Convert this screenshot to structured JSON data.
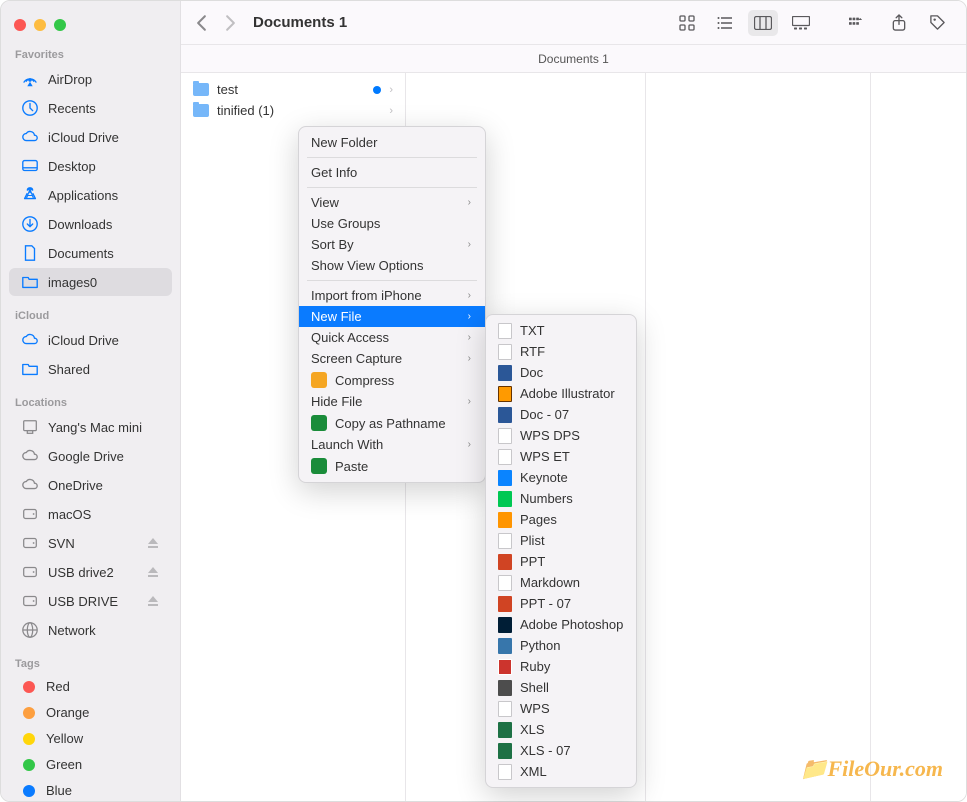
{
  "window": {
    "title": "Documents 1"
  },
  "sidebar": {
    "sections": {
      "favorites": {
        "header": "Favorites",
        "items": [
          {
            "icon": "airdrop",
            "label": "AirDrop"
          },
          {
            "icon": "clock",
            "label": "Recents"
          },
          {
            "icon": "cloud",
            "label": "iCloud Drive"
          },
          {
            "icon": "desktop",
            "label": "Desktop"
          },
          {
            "icon": "apps",
            "label": "Applications"
          },
          {
            "icon": "download",
            "label": "Downloads"
          },
          {
            "icon": "document",
            "label": "Documents"
          },
          {
            "icon": "folder",
            "label": "images0",
            "selected": true
          }
        ]
      },
      "icloud": {
        "header": "iCloud",
        "items": [
          {
            "icon": "cloud",
            "label": "iCloud Drive"
          },
          {
            "icon": "folder",
            "label": "Shared"
          }
        ]
      },
      "locations": {
        "header": "Locations",
        "items": [
          {
            "icon": "computer",
            "label": "Yang's Mac mini"
          },
          {
            "icon": "cloud",
            "label": "Google Drive"
          },
          {
            "icon": "cloud",
            "label": "OneDrive"
          },
          {
            "icon": "disk",
            "label": "macOS"
          },
          {
            "icon": "disk",
            "label": "SVN",
            "eject": true
          },
          {
            "icon": "disk",
            "label": "USB drive2",
            "eject": true
          },
          {
            "icon": "disk",
            "label": "USB DRIVE",
            "eject": true
          },
          {
            "icon": "network",
            "label": "Network"
          }
        ]
      },
      "tags": {
        "header": "Tags",
        "items": [
          {
            "color": "#fc5753",
            "label": "Red"
          },
          {
            "color": "#fd9f40",
            "label": "Orange"
          },
          {
            "color": "#ffd60a",
            "label": "Yellow"
          },
          {
            "color": "#33c748",
            "label": "Green"
          },
          {
            "color": "#0a7bff",
            "label": "Blue"
          }
        ]
      }
    }
  },
  "pathbar": {
    "label": "Documents 1"
  },
  "columns": {
    "col1": {
      "items": [
        {
          "name": "test",
          "hasTag": true
        },
        {
          "name": "tinified (1)",
          "hasTag": false
        }
      ]
    }
  },
  "context_menu": {
    "items": [
      {
        "label": "New Folder"
      },
      {
        "sep": true
      },
      {
        "label": "Get Info"
      },
      {
        "sep": true
      },
      {
        "label": "View",
        "submenu": true
      },
      {
        "label": "Use Groups"
      },
      {
        "label": "Sort By",
        "submenu": true
      },
      {
        "label": "Show View Options"
      },
      {
        "sep": true
      },
      {
        "label": "Import from iPhone",
        "submenu": true
      },
      {
        "label": "New File",
        "submenu": true,
        "highlighted": true
      },
      {
        "label": "Quick Access",
        "submenu": true
      },
      {
        "label": "Screen Capture",
        "submenu": true
      },
      {
        "label": "Compress",
        "icon": "compress",
        "iconColor": "#f5a623"
      },
      {
        "label": "Hide File",
        "submenu": true
      },
      {
        "label": "Copy as Pathname",
        "icon": "copy",
        "iconColor": "#1a8c3a"
      },
      {
        "label": "Launch With",
        "submenu": true
      },
      {
        "label": "Paste",
        "icon": "paste",
        "iconColor": "#1a8c3a"
      }
    ]
  },
  "submenu_newfile": {
    "items": [
      {
        "label": "TXT",
        "iconClass": ""
      },
      {
        "label": "RTF",
        "iconClass": ""
      },
      {
        "label": "Doc",
        "iconClass": "word"
      },
      {
        "label": "Adobe Illustrator",
        "iconClass": "ai"
      },
      {
        "label": "Doc - 07",
        "iconClass": "word"
      },
      {
        "label": "WPS DPS",
        "iconClass": ""
      },
      {
        "label": "WPS ET",
        "iconClass": ""
      },
      {
        "label": "Keynote",
        "iconClass": "keynote"
      },
      {
        "label": "Numbers",
        "iconClass": "numbers"
      },
      {
        "label": "Pages",
        "iconClass": "pages"
      },
      {
        "label": "Plist",
        "iconClass": ""
      },
      {
        "label": "PPT",
        "iconClass": "ppt"
      },
      {
        "label": "Markdown",
        "iconClass": ""
      },
      {
        "label": "PPT - 07",
        "iconClass": "ppt"
      },
      {
        "label": "Adobe Photoshop",
        "iconClass": "ps"
      },
      {
        "label": "Python",
        "iconClass": "python"
      },
      {
        "label": "Ruby",
        "iconClass": "ruby"
      },
      {
        "label": "Shell",
        "iconClass": "shell"
      },
      {
        "label": "WPS",
        "iconClass": ""
      },
      {
        "label": "XLS",
        "iconClass": "xls"
      },
      {
        "label": "XLS - 07",
        "iconClass": "xls"
      },
      {
        "label": "XML",
        "iconClass": ""
      }
    ]
  },
  "watermark": "FileOur.com"
}
